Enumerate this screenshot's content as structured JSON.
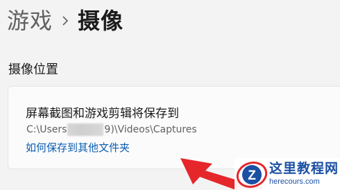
{
  "breadcrumb": {
    "parent": "游戏",
    "separator_icon": "chevron-right-icon",
    "current": "摄像"
  },
  "section": {
    "title": "摄像位置"
  },
  "capture_location_card": {
    "title": "屏幕截图和游戏剪辑将保存到",
    "path_prefix": "C:\\Users",
    "path_suffix": "9)\\Videos\\Captures",
    "link": "如何保存到其他文件夹"
  },
  "overlay": {
    "arrow_color": "#e5262b"
  },
  "watermark": {
    "logo_icon": "z-logo-icon",
    "title": "这里教程网",
    "url": "herecours.com"
  },
  "colors": {
    "background": "#f3f3f3",
    "card": "#fbfbfb",
    "link": "#0a5db3",
    "watermark": "#1b4fa3"
  }
}
